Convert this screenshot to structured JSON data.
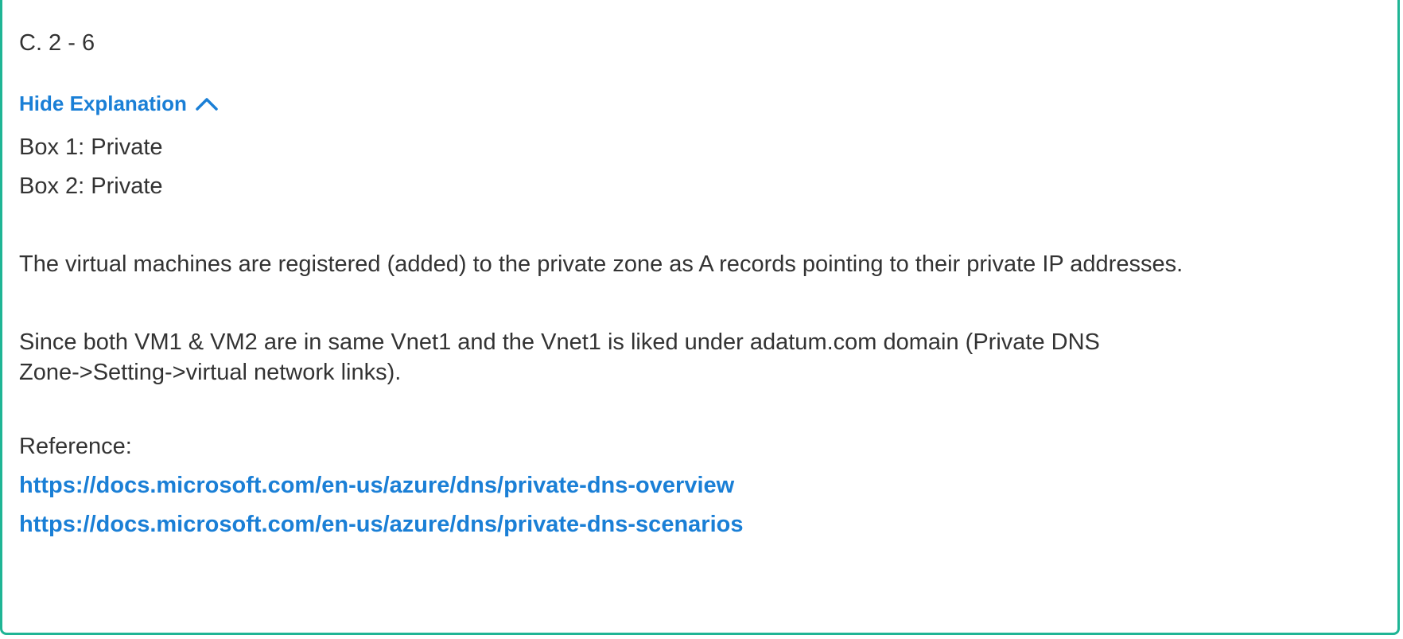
{
  "answer": {
    "text": "C. 2 - 6"
  },
  "explanation_toggle": {
    "label": "Hide Explanation",
    "icon": "chevron-up-icon",
    "color": "#1a7fd6"
  },
  "explanation": {
    "box1": "Box 1: Private",
    "box2": "Box 2: Private",
    "paragraph1": "The virtual machines are registered (added) to the private zone as A records pointing to their private IP addresses.",
    "paragraph2": "Since both VM1 & VM2 are in same Vnet1 and the Vnet1 is liked under adatum.com domain (Private DNS Zone->Setting->virtual network links).",
    "reference_label": "Reference:",
    "links": [
      "https://docs.microsoft.com/en-us/azure/dns/private-dns-overview",
      "https://docs.microsoft.com/en-us/azure/dns/private-dns-scenarios"
    ]
  },
  "colors": {
    "border": "#1fb595",
    "link": "#1a7fd6",
    "text": "#333333"
  }
}
